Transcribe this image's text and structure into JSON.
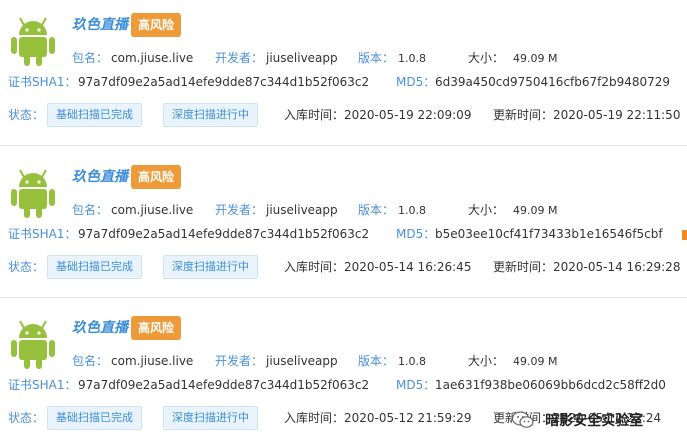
{
  "labels": {
    "package": "包名：",
    "developer": "开发者：",
    "version": "版本：",
    "size": "大小：",
    "sha1": "证书SHA1：",
    "md5": "MD5：",
    "status": "状态：",
    "import_time": "入库时间：",
    "update_time": "更新时间："
  },
  "colors": {
    "accent": "#3e8ed9",
    "risk_badge": "#ee9a38",
    "android_green": "#97c03d",
    "status_bg": "#e8f3fc"
  },
  "apps": [
    {
      "icon": "android-icon",
      "name": "玖色直播",
      "risk": "高风险",
      "package": "com.jiuse.live",
      "developer": "jiuseliveapp",
      "version": "1.0.8",
      "size": "49.09 M",
      "sha1": "97a7df09e2a5ad14efe9dde87c344d1b52f063c2",
      "md5": "6d39a450cd9750416cfb67f2b9480729",
      "status_basic": "基础扫描已完成",
      "status_deep": "深度扫描进行中",
      "import_time": "2020-05-19 22:09:09",
      "update_time": "2020-05-19 22:11:50"
    },
    {
      "icon": "android-icon",
      "name": "玖色直播",
      "risk": "高风险",
      "package": "com.jiuse.live",
      "developer": "jiuseliveapp",
      "version": "1.0.8",
      "size": "49.09 M",
      "sha1": "97a7df09e2a5ad14efe9dde87c344d1b52f063c2",
      "md5": "b5e03ee10cf41f73433b1e16546f5cbf",
      "status_basic": "基础扫描已完成",
      "status_deep": "深度扫描进行中",
      "import_time": "2020-05-14 16:26:45",
      "update_time": "2020-05-14 16:29:28"
    },
    {
      "icon": "android-icon",
      "name": "玖色直播",
      "risk": "高风险",
      "package": "com.jiuse.live",
      "developer": "jiuseliveapp",
      "version": "1.0.8",
      "size": "49.09 M",
      "sha1": "97a7df09e2a5ad14efe9dde87c344d1b52f063c2",
      "md5": "1ae631f938be06069bb6dcd2c58ff2d0",
      "status_basic": "基础扫描已完成",
      "status_deep": "深度扫描进行中",
      "import_time": "2020-05-12 21:59:29",
      "update_time": "2020-05-12 22:24"
    }
  ],
  "watermark": {
    "icon": "wechat-icon",
    "text": "暗影安全实验室"
  }
}
